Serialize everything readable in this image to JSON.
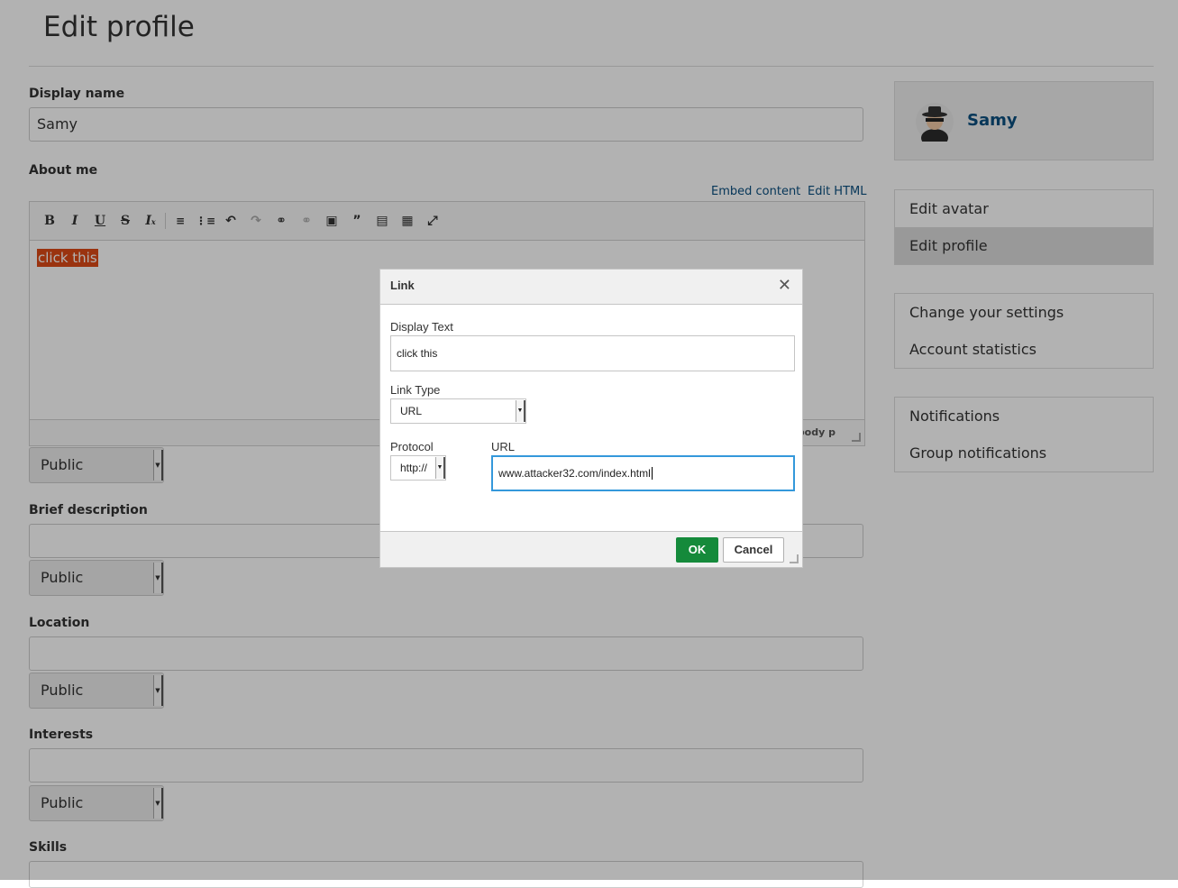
{
  "page": {
    "title": "Edit profile"
  },
  "form": {
    "display_name": {
      "label": "Display name",
      "value": "Samy"
    },
    "about_me": {
      "label": "About me",
      "embed_link": "Embed content",
      "edit_html_link": "Edit HTML",
      "content": "click this",
      "status_path": "body  p",
      "access": "Public"
    },
    "brief_description": {
      "label": "Brief description",
      "value": "",
      "access": "Public"
    },
    "location": {
      "label": "Location",
      "value": "",
      "access": "Public"
    },
    "interests": {
      "label": "Interests",
      "value": "",
      "access": "Public"
    },
    "skills": {
      "label": "Skills"
    }
  },
  "toolbar": {
    "icons": [
      "bold-icon",
      "italic-icon",
      "underline-icon",
      "strikethrough-icon",
      "remove-format-icon",
      "numbered-list-icon",
      "bulleted-list-icon",
      "undo-icon",
      "redo-icon",
      "link-icon",
      "unlink-icon",
      "image-icon",
      "blockquote-icon",
      "paste-icon",
      "paste-text-icon",
      "maximize-icon"
    ]
  },
  "sidebar": {
    "owner_name": "Samy",
    "menu_1": [
      "Edit avatar",
      "Edit profile"
    ],
    "menu_2": [
      "Change your settings",
      "Account statistics"
    ],
    "menu_3": [
      "Notifications",
      "Group notifications"
    ]
  },
  "dialog": {
    "title": "Link",
    "display_text_label": "Display Text",
    "display_text_value": "click this",
    "link_type_label": "Link Type",
    "link_type_value": "URL",
    "protocol_label": "Protocol",
    "protocol_value": "http://",
    "url_label": "URL",
    "url_value": "www.attacker32.com/index.html",
    "ok_label": "OK",
    "cancel_label": "Cancel"
  },
  "colors": {
    "accent": "#0b4f80",
    "ok_button": "#158a3b",
    "selection": "#dd4a16",
    "focus": "#3498db"
  }
}
